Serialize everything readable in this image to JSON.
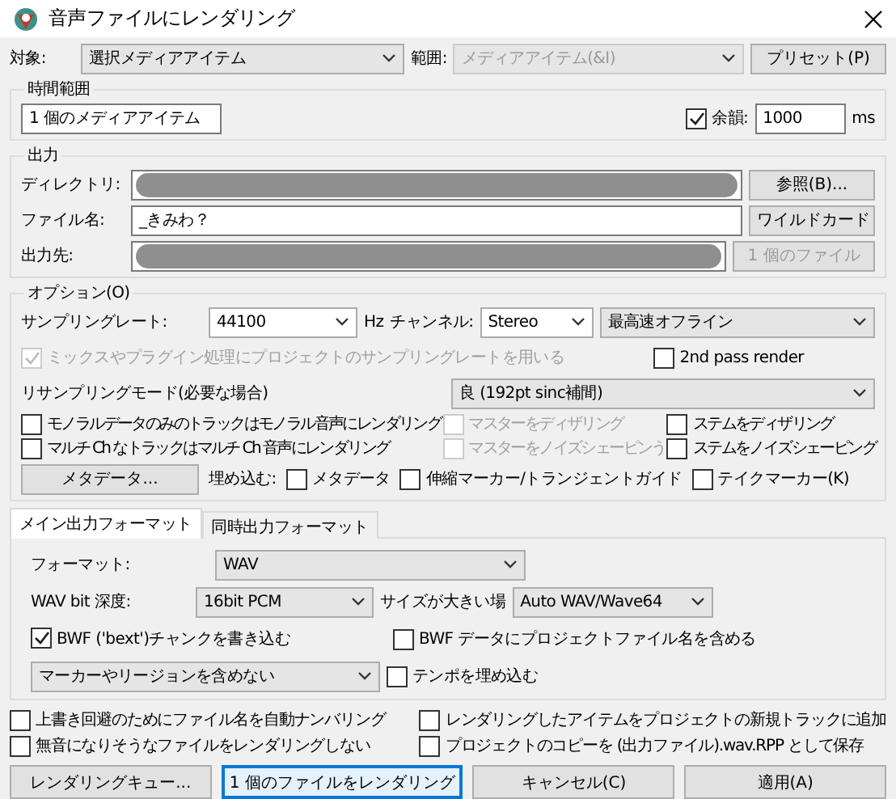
{
  "window": {
    "title": "音声ファイルにレンダリング"
  },
  "target": {
    "label": "対象:",
    "value": "選択メディアアイテム"
  },
  "range": {
    "label": "範囲:",
    "value": "メディアアイテム(&I)",
    "disabled": true
  },
  "preset_button": "プリセット(P)",
  "time_range": {
    "title": "時間範囲",
    "value": "1 個のメディアアイテム",
    "tail": {
      "label": "余韻:",
      "checked": true
    },
    "tail_value": "1000",
    "tail_unit": "ms"
  },
  "output": {
    "title": "出力",
    "directory_label": "ディレクトリ:",
    "browse_button": "参照(B)...",
    "filename_label": "ファイル名:",
    "filename": "_きみわ？",
    "wildcard_button": "ワイルドカード",
    "destination_label": "出力先:",
    "files_button": {
      "label": "1 個のファイル",
      "disabled": true
    }
  },
  "options": {
    "title": "オプション(O)",
    "sample_rate_label": "サンプリングレート:",
    "sample_rate": "44100",
    "sample_rate_unit": "Hz",
    "channel_label": "チャンネル:",
    "channel": "Stereo",
    "speed": "最高速オフライン",
    "use_project_rate": {
      "label": "ミックスやプラグイン処理にプロジェクトのサンプリングレートを用いる",
      "checked": true,
      "disabled": true
    },
    "second_pass": {
      "label": "2nd pass render",
      "checked": false,
      "disabled": false
    },
    "resample_label": "リサンプリングモード(必要な場合)",
    "resample": "良 (192pt sinc補間)",
    "checks": [
      {
        "label": "モノラルデータのみのトラックはモノラル音声にレンダリング",
        "checked": false,
        "disabled": false
      },
      {
        "label": "マスターをディザリング",
        "checked": false,
        "disabled": true
      },
      {
        "label": "ステムをディザリング",
        "checked": false,
        "disabled": false
      },
      {
        "label": "マルチ Ch なトラックはマルチ Ch 音声にレンダリング",
        "checked": false,
        "disabled": false
      },
      {
        "label": "マスターをノイズシェーピンう",
        "checked": false,
        "disabled": true
      },
      {
        "label": "ステムをノイズシェーピング",
        "checked": false,
        "disabled": false
      }
    ],
    "metadata_button": "メタデータ...",
    "embed_label": "埋め込む:",
    "embed": [
      {
        "label": "メタデータ",
        "checked": false
      },
      {
        "label": "伸縮マーカー/トランジェントガイド",
        "checked": false
      },
      {
        "label": "テイクマーカー(K)",
        "checked": false
      }
    ]
  },
  "tabs": [
    {
      "label": "メイン出力フォーマット",
      "selected": true
    },
    {
      "label": "同時出力フォーマット",
      "selected": false
    }
  ],
  "format": {
    "format_label": "フォーマット:",
    "format": "WAV",
    "bit_label": "WAV bit 深度:",
    "bit": "16bit PCM",
    "large_label": "サイズが大きい場",
    "large": "Auto WAV/Wave64",
    "bwf": {
      "label": "BWF ('bext')チャンクを書き込む",
      "checked": true
    },
    "bwf_project": {
      "label": "BWF データにプロジェクトファイル名を含める",
      "checked": false
    },
    "markers": "マーカーやリージョンを含めない",
    "tempo": {
      "label": "テンポを埋め込む",
      "checked": false
    }
  },
  "bottom_checks": [
    {
      "label": "上書き回避のためにファイル名を自動ナンバリング",
      "checked": false
    },
    {
      "label": "レンダリングしたアイテムをプロジェクトの新規トラックに追加",
      "checked": false
    },
    {
      "label": "無音になりそうなファイルをレンダリングしない",
      "checked": false
    },
    {
      "label": "プロジェクトのコピーを (出力ファイル).wav.RPP として保存",
      "checked": false
    }
  ],
  "buttons": [
    {
      "label": "レンダリングキュー...",
      "default": false
    },
    {
      "label": "1 個のファイルをレンダリング",
      "default": true
    },
    {
      "label": "キャンセル(C)",
      "default": false
    },
    {
      "label": "適用(A)",
      "default": false
    }
  ]
}
